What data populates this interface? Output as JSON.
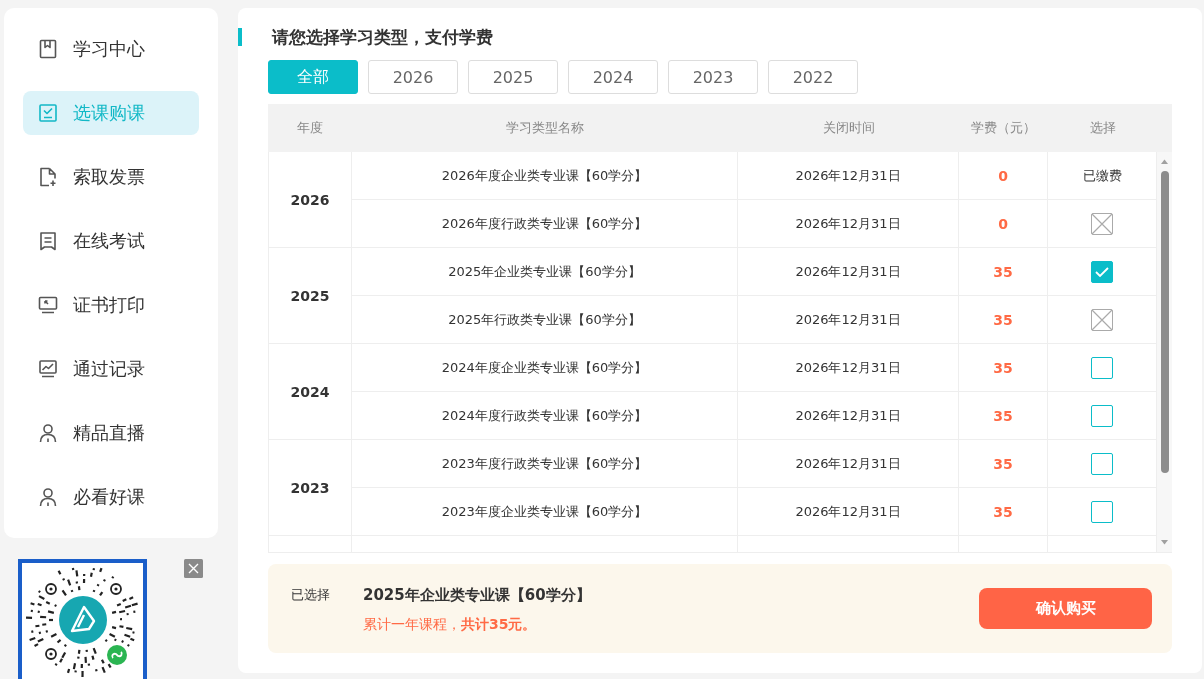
{
  "sidebar": {
    "items": [
      {
        "label": "学习中心",
        "selected": false
      },
      {
        "label": "选课购课",
        "selected": true
      },
      {
        "label": "索取发票",
        "selected": false
      },
      {
        "label": "在线考试",
        "selected": false
      },
      {
        "label": "证书打印",
        "selected": false
      },
      {
        "label": "通过记录",
        "selected": false
      },
      {
        "label": "精品直播",
        "selected": false
      },
      {
        "label": "必看好课",
        "selected": false
      }
    ]
  },
  "main": {
    "title": "请您选择学习类型，支付学费",
    "year_tabs": [
      {
        "label": "全部",
        "selected": true
      },
      {
        "label": "2026",
        "selected": false
      },
      {
        "label": "2025",
        "selected": false
      },
      {
        "label": "2024",
        "selected": false
      },
      {
        "label": "2023",
        "selected": false
      },
      {
        "label": "2022",
        "selected": false
      }
    ],
    "table": {
      "columns": [
        "年度",
        "学习类型名称",
        "关闭时间",
        "学费（元）",
        "选择"
      ],
      "groups": [
        {
          "year": "2026",
          "rows": [
            {
              "name": "2026年度企业类专业课【60学分】",
              "close_time": "2026年12月31日",
              "fee": "0",
              "choice": {
                "kind": "paid",
                "label": "已缴费"
              }
            },
            {
              "name": "2026年度行政类专业课【60学分】",
              "close_time": "2026年12月31日",
              "fee": "0",
              "choice": {
                "kind": "unavailable"
              }
            }
          ]
        },
        {
          "year": "2025",
          "rows": [
            {
              "name": "2025年企业类专业课【60学分】",
              "close_time": "2026年12月31日",
              "fee": "35",
              "choice": {
                "kind": "checkbox",
                "checked": true
              }
            },
            {
              "name": "2025年行政类专业课【60学分】",
              "close_time": "2026年12月31日",
              "fee": "35",
              "choice": {
                "kind": "unavailable"
              }
            }
          ]
        },
        {
          "year": "2024",
          "rows": [
            {
              "name": "2024年度企业类专业课【60学分】",
              "close_time": "2026年12月31日",
              "fee": "35",
              "choice": {
                "kind": "checkbox",
                "checked": false
              }
            },
            {
              "name": "2024年度行政类专业课【60学分】",
              "close_time": "2026年12月31日",
              "fee": "35",
              "choice": {
                "kind": "checkbox",
                "checked": false
              }
            }
          ]
        },
        {
          "year": "2023",
          "rows": [
            {
              "name": "2023年度行政类专业课【60学分】",
              "close_time": "2026年12月31日",
              "fee": "35",
              "choice": {
                "kind": "checkbox",
                "checked": false
              }
            },
            {
              "name": "2023年度企业类专业课【60学分】",
              "close_time": "2026年12月31日",
              "fee": "35",
              "choice": {
                "kind": "checkbox",
                "checked": false
              }
            }
          ]
        }
      ]
    },
    "selection": {
      "label": "已选择",
      "course": "2025年企业类专业课【60学分】",
      "summary": "累计一年课程，**共计35元。**",
      "confirm_button": "确认购买"
    }
  }
}
